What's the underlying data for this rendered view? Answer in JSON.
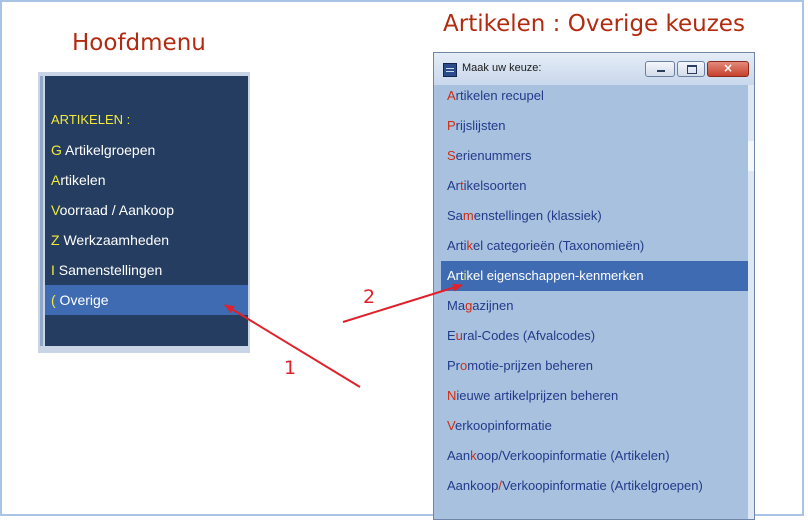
{
  "titles": {
    "left": "Hoofdmenu",
    "right": "Artikelen : Overige keuzes"
  },
  "main_menu": {
    "heading": "ARTIKELEN :",
    "items": [
      {
        "hot": "G",
        "rest": " Artikelgroepen",
        "selected": false
      },
      {
        "hot": "A",
        "rest": "rtikelen",
        "selected": false
      },
      {
        "hot": "V",
        "rest": "oorraad / Aankoop",
        "selected": false
      },
      {
        "hot": "Z",
        "rest": " Werkzaamheden",
        "selected": false
      },
      {
        "hot": "I",
        "rest": " Samenstellingen",
        "selected": false
      },
      {
        "hot": "(",
        "rest": " Overige",
        "selected": true
      }
    ]
  },
  "window": {
    "title": "Maak uw keuze:",
    "close_glyph": "×",
    "options": [
      {
        "pre": "",
        "hot": "A",
        "rest": "rtikelen recupel",
        "selected": false
      },
      {
        "pre": "",
        "hot": "P",
        "rest": "rijslijsten",
        "selected": false
      },
      {
        "pre": "",
        "hot": "S",
        "rest": "erienummers",
        "selected": false
      },
      {
        "pre": "Ar",
        "hot": "t",
        "rest": "ikelsoorten",
        "selected": false
      },
      {
        "pre": "Sa",
        "hot": "m",
        "rest": "enstellingen (klassiek)",
        "selected": false
      },
      {
        "pre": "Arti",
        "hot": "k",
        "rest": "el categorieën (Taxonomieën)",
        "selected": false
      },
      {
        "pre": "Art",
        "hot": "i",
        "rest": "kel eigenschappen-kenmerken",
        "selected": true
      },
      {
        "pre": "Ma",
        "hot": "g",
        "rest": "azijnen",
        "selected": false
      },
      {
        "pre": "E",
        "hot": "u",
        "rest": "ral-Codes (Afvalcodes)",
        "selected": false
      },
      {
        "pre": "Pr",
        "hot": "o",
        "rest": "motie-prijzen beheren",
        "selected": false
      },
      {
        "pre": "",
        "hot": "N",
        "rest": "ieuwe artikelprijzen beheren",
        "selected": false
      },
      {
        "pre": "",
        "hot": "V",
        "rest": "erkoopinformatie",
        "selected": false
      },
      {
        "pre": "Aan",
        "hot": "k",
        "rest": "oop/Verkoopinformatie (Artikelen)",
        "selected": false
      },
      {
        "pre": "Aankoop",
        "hot": "/",
        "rest": "Verkoopinformatie (Artikelgroepen)",
        "selected": false
      }
    ]
  },
  "annotations": {
    "label_1": "1",
    "label_2": "2",
    "arrow_color": "#e0202a"
  },
  "colors": {
    "title_red": "#b22a0f",
    "menu_bg": "#243d60",
    "selection": "#3f6bb2",
    "hotkey_yellow": "#f3ea3a",
    "window_bg": "#a7c1df",
    "option_text": "#233a8a",
    "hotkey_red": "#d22a12"
  }
}
